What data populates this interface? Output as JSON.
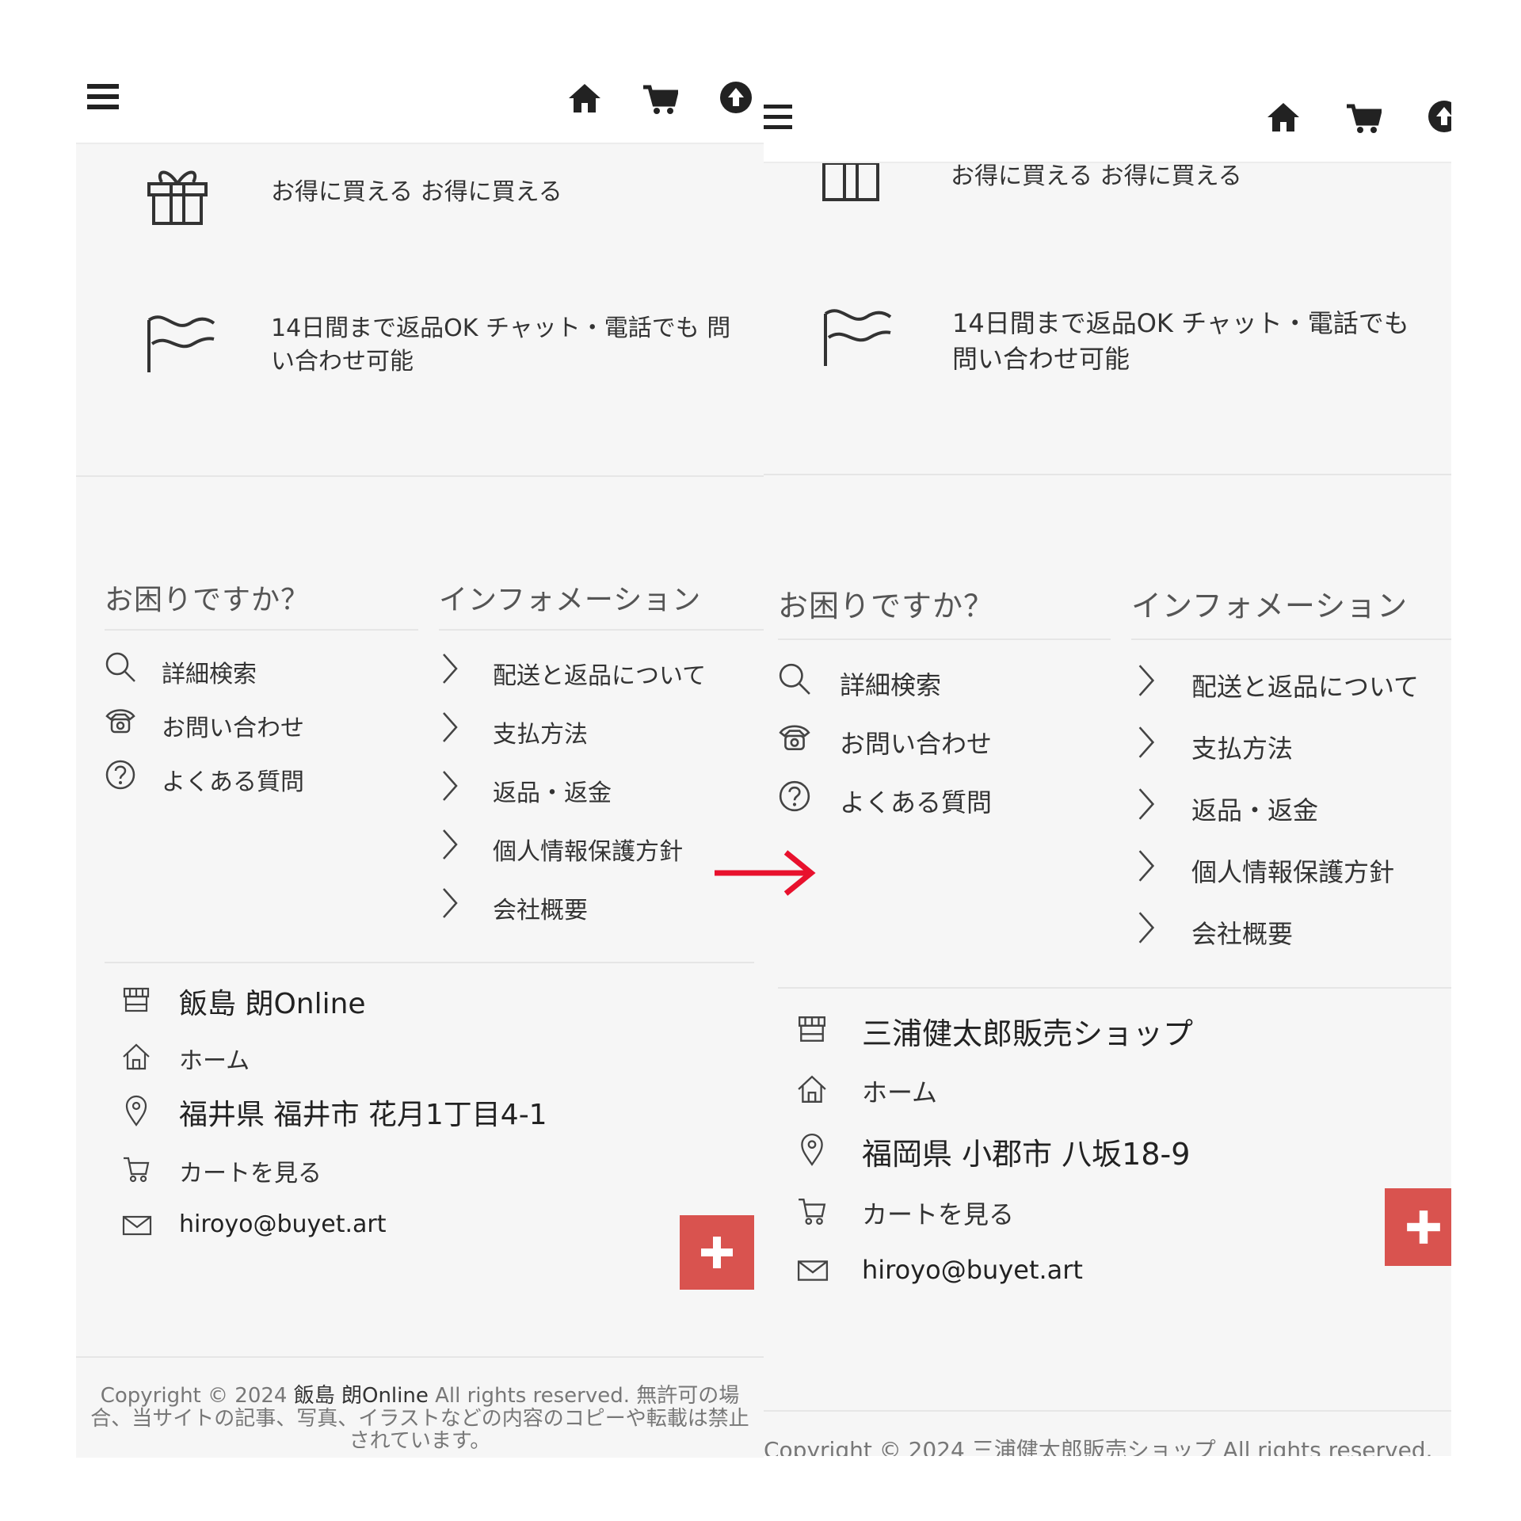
{
  "feature": {
    "gift_text": "お得に買える お得に買える",
    "returns_text": "14日間まで返品OK チャット・電話でも 問い合わせ可能"
  },
  "help": {
    "heading": "お困りですか？",
    "items": [
      {
        "label": "詳細検索",
        "icon": "search-icon"
      },
      {
        "label": "お問い合わせ",
        "icon": "phone-icon"
      },
      {
        "label": "よくある質問",
        "icon": "help-circle-icon"
      }
    ]
  },
  "info": {
    "heading": "インフォメーション",
    "items": [
      {
        "label": "配送と返品について"
      },
      {
        "label": "支払方法"
      },
      {
        "label": "返品・返金"
      },
      {
        "label": "個人情報保護方針"
      },
      {
        "label": "会社概要"
      }
    ]
  },
  "before": {
    "shop_name": "飯島 朗Online",
    "home": "ホーム",
    "address": "福井県 福井市 花月1丁目4-1",
    "cart": "カートを見る",
    "email": "hiroyo@buyet.art",
    "copyright": {
      "prefix": "Copyright ©  2024 ",
      "owner": "飯島 朗Online",
      "suffix": "  All rights reserved.   無許可の場合、当サイトの記事、写真、イラストなどの内容のコピーや転載は禁止されています。"
    }
  },
  "after": {
    "shop_name": "三浦健太郎販売ショップ",
    "home": "ホーム",
    "address": "福岡県 小郡市 八坂18-9",
    "cart": "カートを見る",
    "email": "hiroyo@buyet.art",
    "copyright_partial": "Copyright ©  2024 三浦健太郎販売ショップ  All rights reserved."
  },
  "colors": {
    "accent_red": "#d9534f",
    "arrow_red": "#e8112d",
    "footer_bg": "#f6f6f6"
  }
}
